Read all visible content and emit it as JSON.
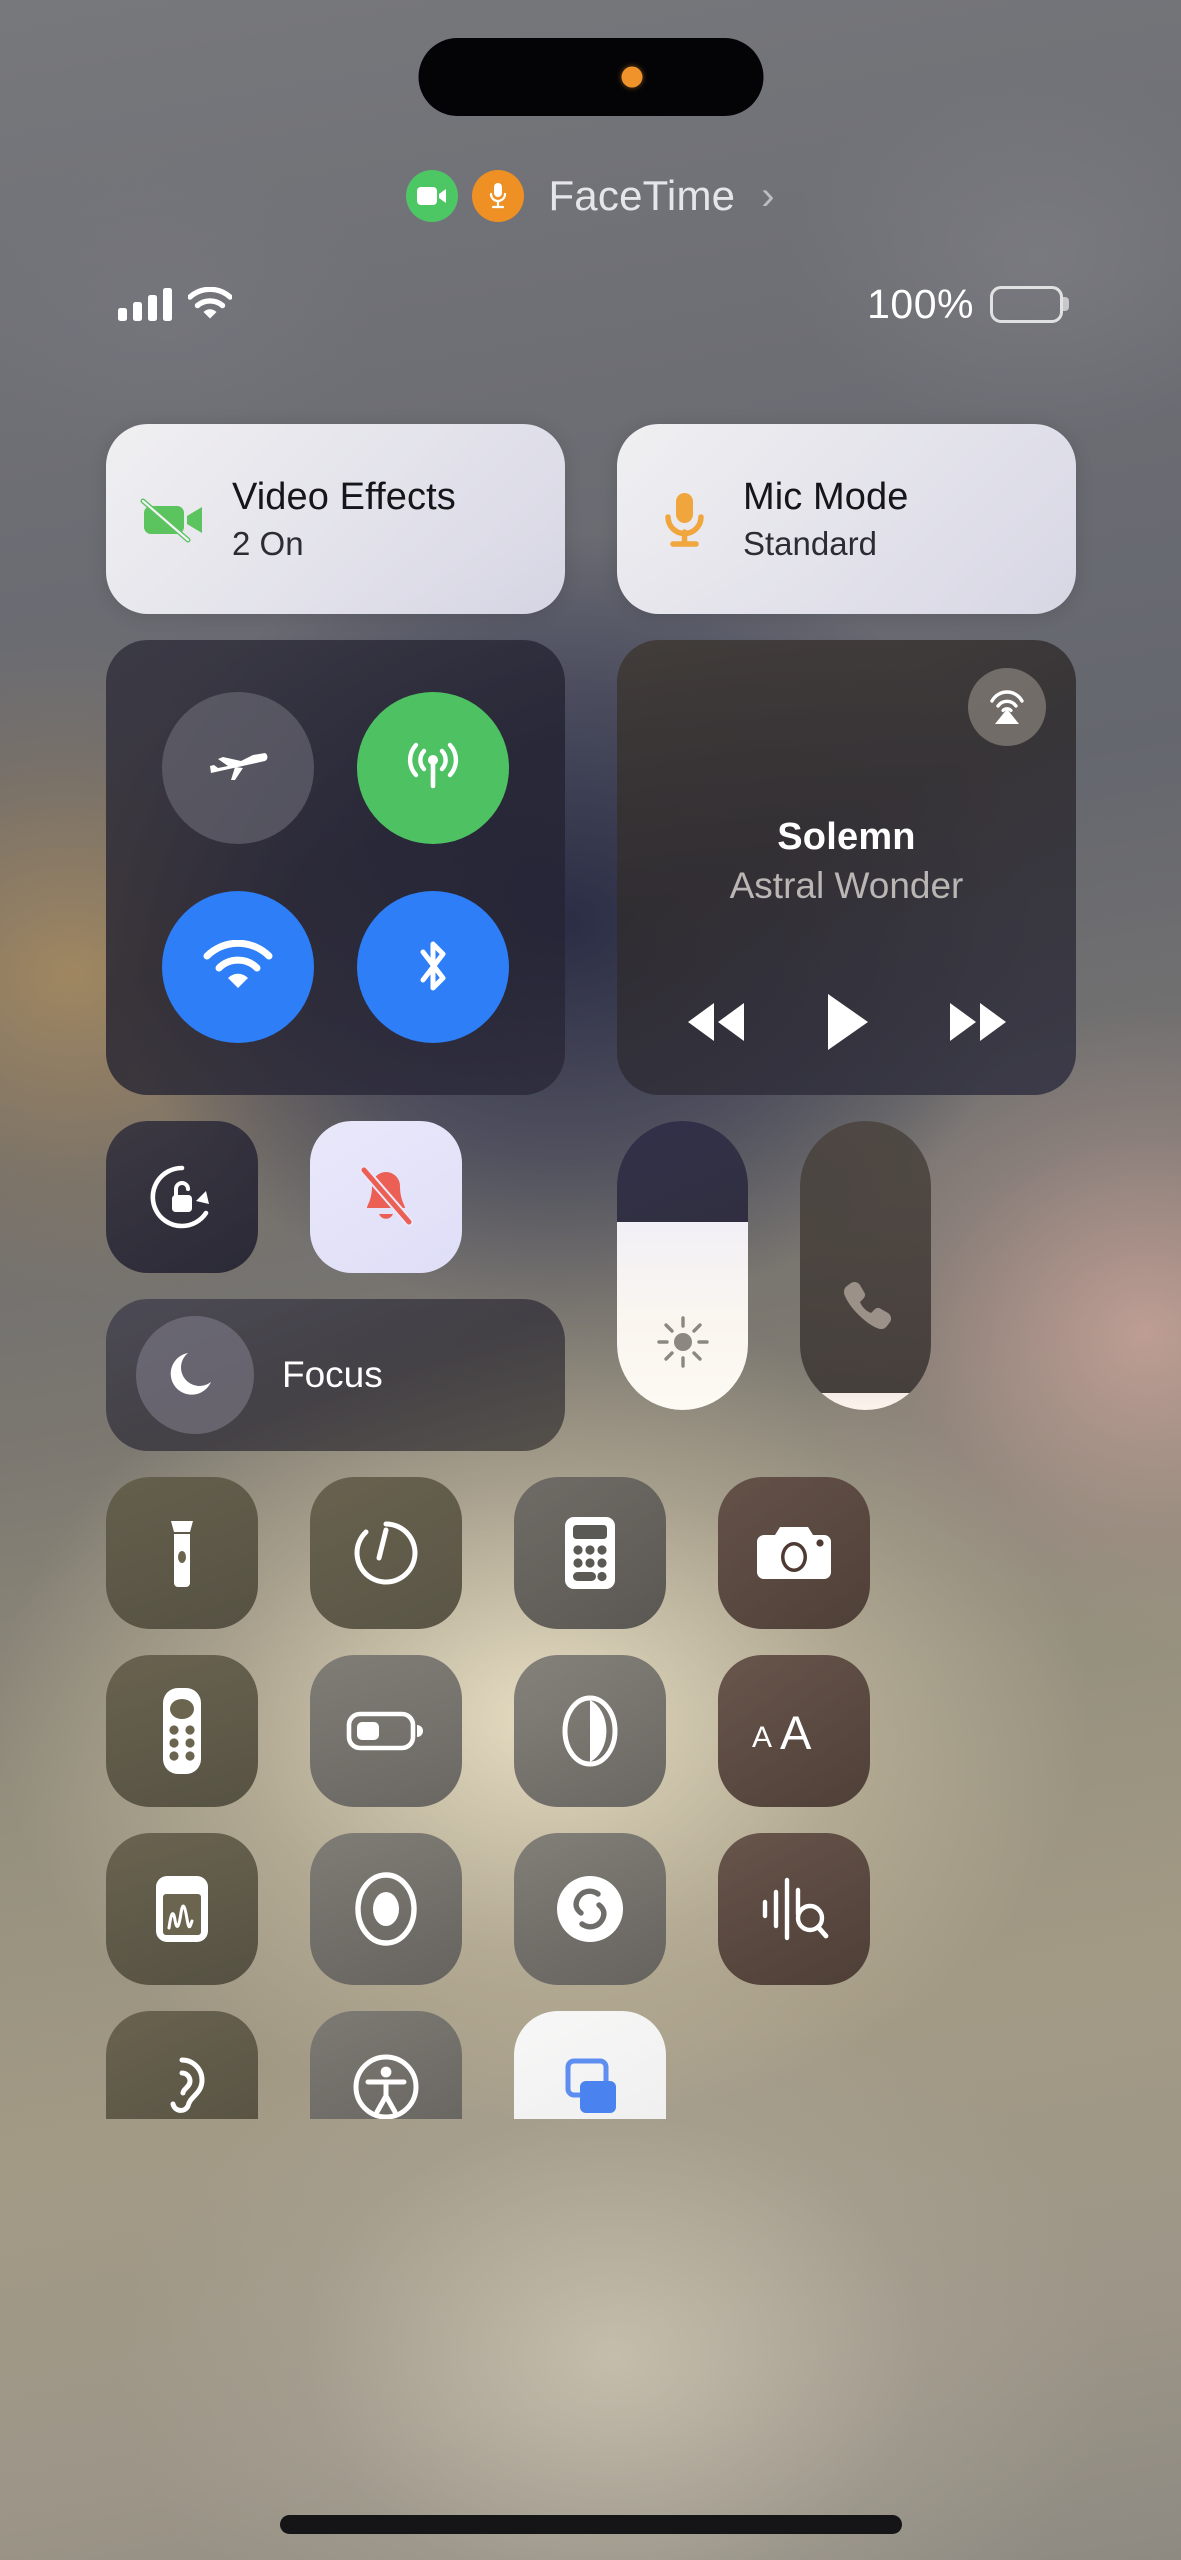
{
  "status_bar": {
    "signal_icon": "cellular-bars-icon",
    "wifi_icon": "wifi-icon",
    "battery_percent": "100%",
    "battery_icon": "battery-full-icon",
    "battery_level": 100
  },
  "dynamic_island": {
    "privacy_indicator": "microphone-in-use-dot",
    "privacy_color": "#f0932b"
  },
  "call_banner": {
    "app_label": "FaceTime",
    "camera_icon": "video-camera-icon",
    "camera_color": "#4cc764",
    "mic_icon": "microphone-icon",
    "mic_color": "#ef9024",
    "chevron": "›"
  },
  "call_controls": [
    {
      "id": "video-effects",
      "title": "Video Effects",
      "subtitle": "2 On",
      "icon": "video-camera-slash-icon",
      "icon_color": "#5cc45f"
    },
    {
      "id": "mic-mode",
      "title": "Mic Mode",
      "subtitle": "Standard",
      "icon": "microphone-icon",
      "icon_color": "#f0a63c"
    }
  ],
  "connectivity": {
    "name": "connectivity-module",
    "toggles": [
      {
        "id": "airplane-mode",
        "label": "Airplane Mode",
        "icon": "airplane-icon",
        "state": "off",
        "bg": "rgba(115,114,126,.55)"
      },
      {
        "id": "cellular-data",
        "label": "Cellular Data",
        "icon": "cellular-antenna-icon",
        "state": "on",
        "bg": "#4ec263"
      },
      {
        "id": "wifi",
        "label": "Wi-Fi",
        "icon": "wifi-icon",
        "state": "on",
        "bg": "#2d7ef7"
      },
      {
        "id": "bluetooth",
        "label": "Bluetooth",
        "icon": "bluetooth-icon",
        "state": "on",
        "bg": "#2d7ef7"
      }
    ]
  },
  "now_playing": {
    "name": "now-playing-module",
    "track_title": "Solemn",
    "artist": "Astral Wonder",
    "airplay_icon": "airplay-audio-icon",
    "controls": [
      {
        "id": "rewind",
        "label": "Rewind",
        "icon": "rewind-icon"
      },
      {
        "id": "play",
        "label": "Play",
        "icon": "play-icon"
      },
      {
        "id": "fast-forward",
        "label": "Fast Forward",
        "icon": "fast-forward-icon"
      }
    ]
  },
  "quick_toggles": [
    {
      "id": "rotation-lock",
      "label": "Rotation Lock",
      "icon": "rotation-lock-icon",
      "state": "off"
    },
    {
      "id": "silent-mode",
      "label": "Silent Mode",
      "icon": "bell-slash-icon",
      "state": "on",
      "icon_color": "#ec5f54"
    }
  ],
  "sliders": [
    {
      "id": "brightness",
      "label": "Brightness",
      "icon": "sun-icon",
      "value": 65
    },
    {
      "id": "volume",
      "label": "Volume",
      "icon": "phone-handset-icon",
      "value": 6
    }
  ],
  "focus": {
    "id": "focus-module",
    "label": "Focus",
    "icon": "crescent-moon-icon"
  },
  "utility_tiles": [
    [
      {
        "id": "flashlight",
        "label": "Flashlight",
        "icon": "flashlight-icon",
        "tone": "a"
      },
      {
        "id": "timer",
        "label": "Timer",
        "icon": "timer-icon",
        "tone": "a"
      },
      {
        "id": "calculator",
        "label": "Calculator",
        "icon": "calculator-icon",
        "tone": "c"
      },
      {
        "id": "camera",
        "label": "Camera",
        "icon": "camera-icon",
        "tone": "d"
      }
    ],
    [
      {
        "id": "apple-tv-remote",
        "label": "Apple TV Remote",
        "icon": "tv-remote-icon",
        "tone": "a"
      },
      {
        "id": "low-power-mode",
        "label": "Low Power Mode",
        "icon": "battery-icon",
        "tone": "e"
      },
      {
        "id": "dark-mode",
        "label": "Dark Mode",
        "icon": "contrast-circle-icon",
        "tone": "e"
      },
      {
        "id": "text-size",
        "label": "Text Size",
        "icon": "text-size-aa-icon",
        "tone": "d"
      }
    ],
    [
      {
        "id": "quick-note",
        "label": "Quick Note",
        "icon": "quick-note-icon",
        "tone": "a"
      },
      {
        "id": "screen-recording",
        "label": "Screen Recording",
        "icon": "record-circle-icon",
        "tone": "e"
      },
      {
        "id": "shazam",
        "label": "Music Recognition",
        "icon": "shazam-icon",
        "tone": "e"
      },
      {
        "id": "sound-recognition",
        "label": "Sound Recognition",
        "icon": "sound-recognition-icon",
        "tone": "d"
      }
    ],
    [
      {
        "id": "hearing",
        "label": "Hearing",
        "icon": "ear-icon",
        "tone": "a"
      },
      {
        "id": "accessibility-shortcuts",
        "label": "Accessibility Shortcuts",
        "icon": "accessibility-icon",
        "tone": "e"
      },
      {
        "id": "guided-access",
        "label": "Guided Access",
        "icon": "guided-access-icon",
        "tone": "f"
      }
    ]
  ],
  "home_indicator": "home-indicator"
}
